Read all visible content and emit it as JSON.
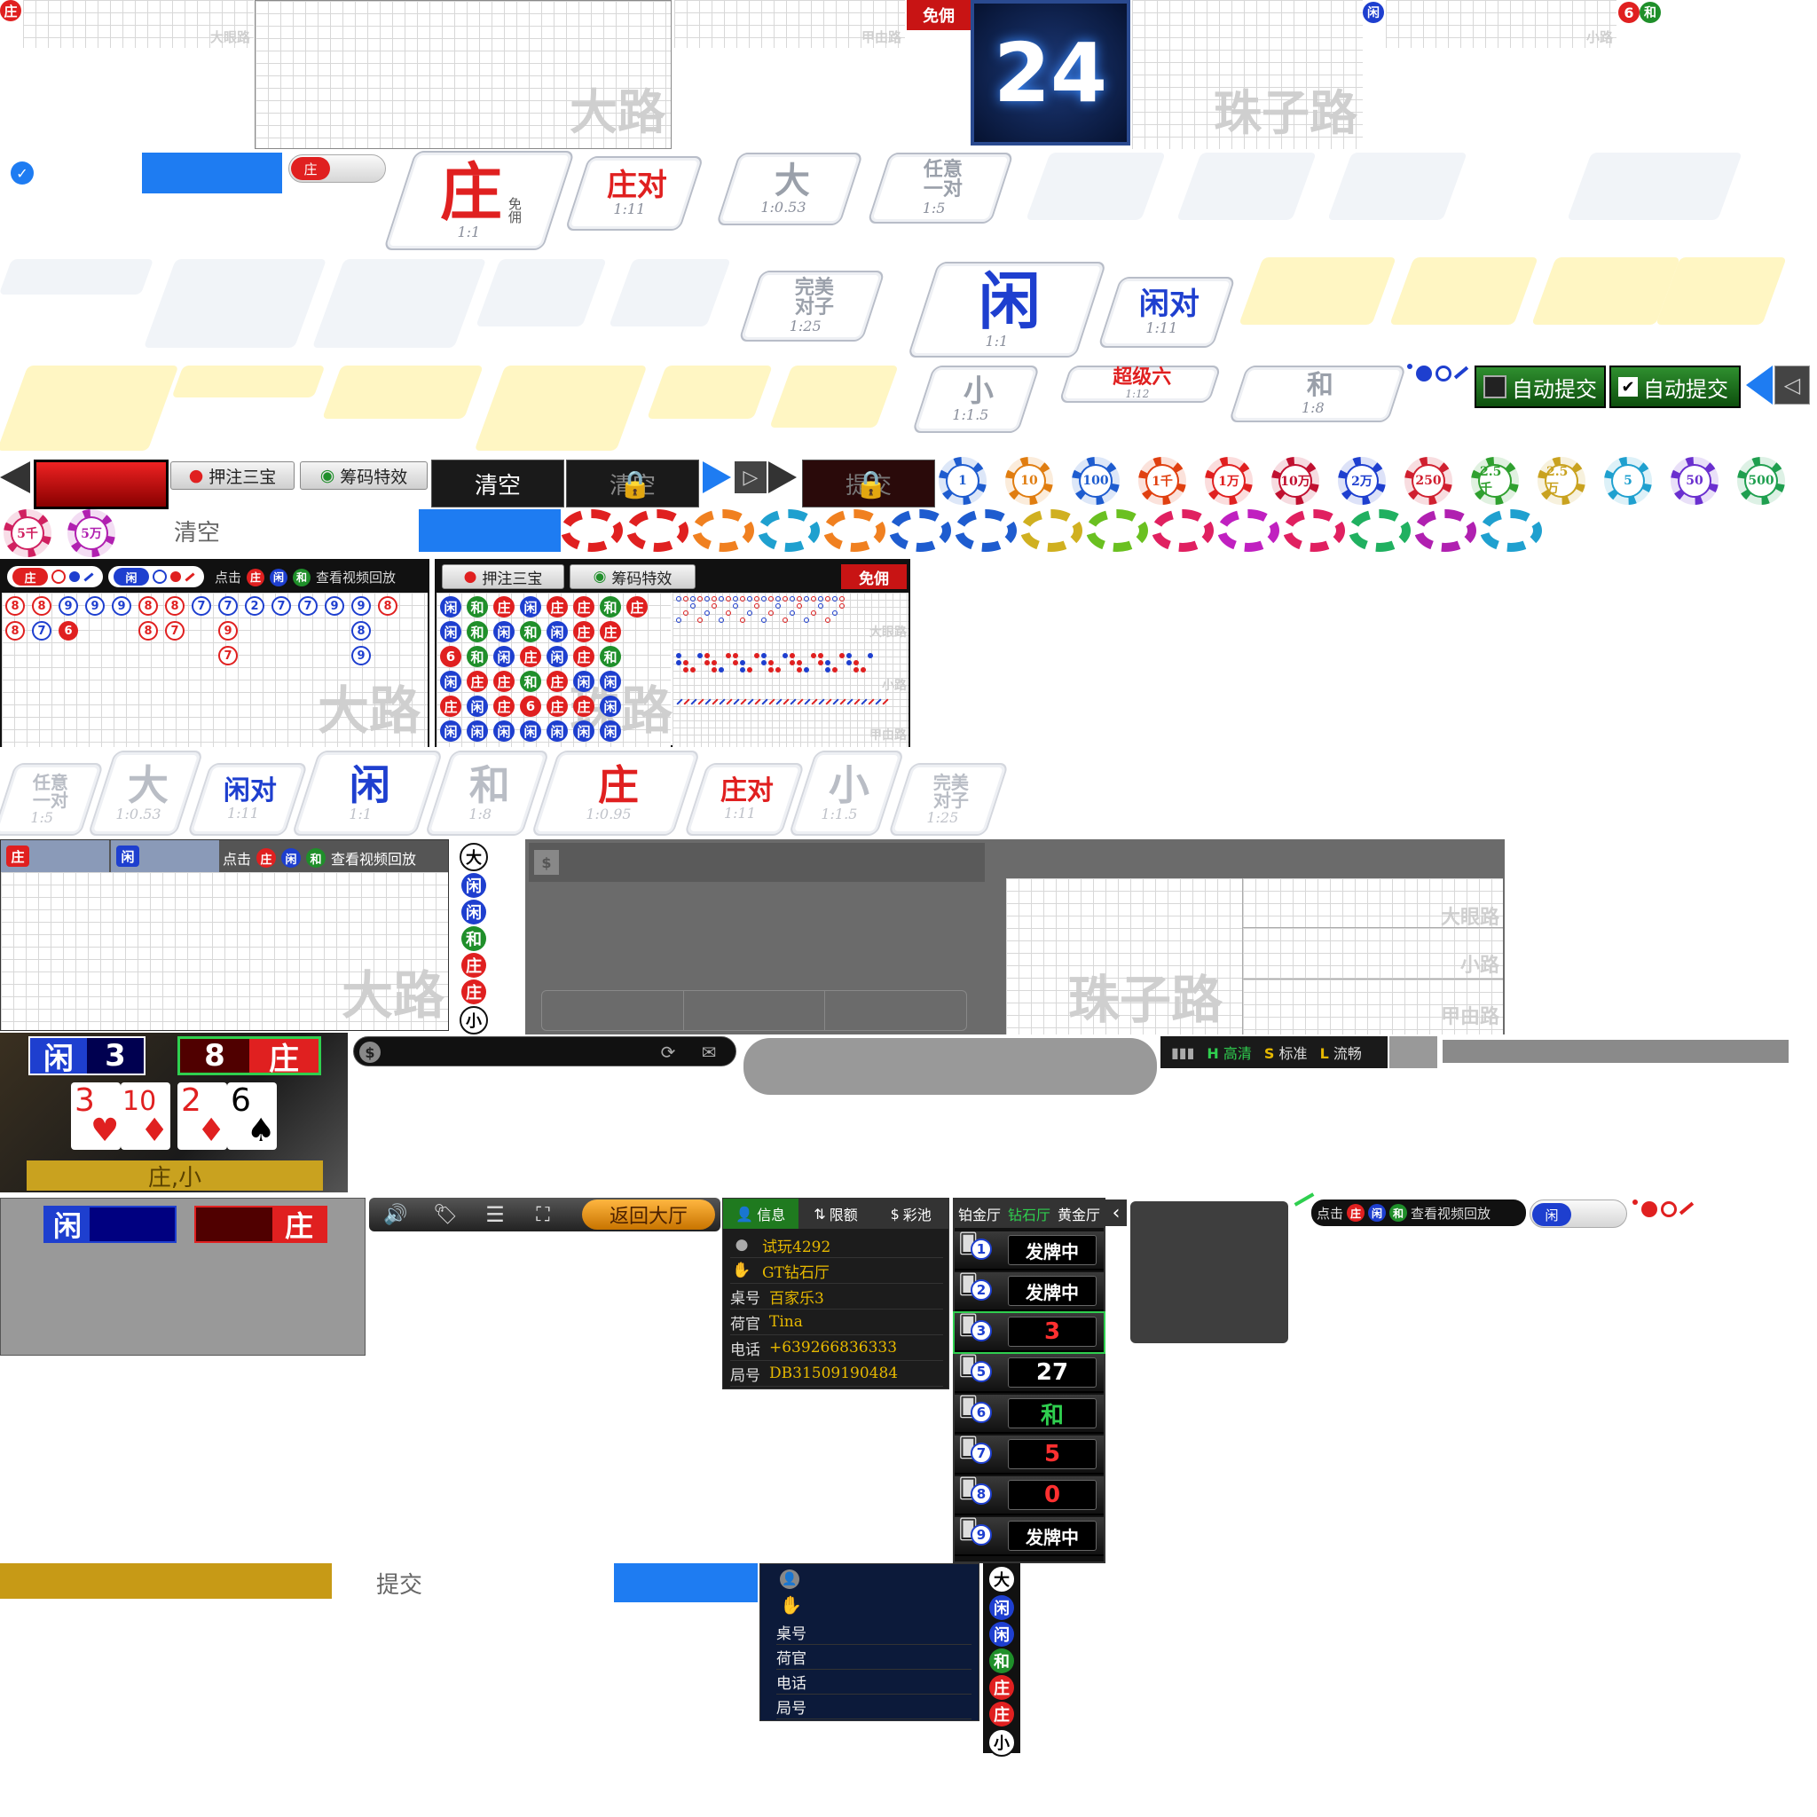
{
  "colors": {
    "banker": "#e02020",
    "player": "#1e3fcf",
    "tie": "#1f8f2a",
    "accent_blue": "#1e7cf2",
    "gold": "#c79a16"
  },
  "top": {
    "banker_badge": "庄",
    "big_eye_road_small": "大眼路",
    "big_road_label": "大路",
    "cockroach_road_small": "甲由路",
    "commission_free": "免佣",
    "countdown": "24",
    "bead_road_label": "珠子路",
    "player_badge": "闲",
    "six_badge": "6",
    "tie_badge": "和",
    "small_road_small": "小路"
  },
  "toggle_banker": "庄",
  "bets_top": [
    {
      "main": "庄",
      "sub": "免佣",
      "odds": "1:1",
      "color": "#e02020"
    },
    {
      "main": "庄对",
      "odds": "1:11",
      "color": "#e02020"
    },
    {
      "main": "大",
      "odds": "1:0.53",
      "color": "#9aa0aa"
    },
    {
      "main": "任意一对",
      "odds": "1:5",
      "color": "#9aa0aa"
    }
  ],
  "bets_mid": [
    {
      "main": "完美对子",
      "odds": "1:25",
      "color": "#9aa0aa"
    },
    {
      "main": "闲",
      "odds": "1:1",
      "color": "#1e3fcf"
    },
    {
      "main": "闲对",
      "odds": "1:11",
      "color": "#1e3fcf"
    }
  ],
  "bets_row3": [
    {
      "main": "小",
      "odds": "1:1.5",
      "color": "#9aa0aa"
    },
    {
      "main": "超级六",
      "odds": "1:12",
      "color": "#e02020"
    },
    {
      "main": "和",
      "odds": "1:8",
      "color": "#9aa0aa"
    }
  ],
  "auto_submit": {
    "off": "自动提交",
    "on": "自动提交"
  },
  "toolbar": {
    "bet_three": "押注三宝",
    "chip_effect": "筹码特效",
    "clear": "清空",
    "clear_locked": "清空",
    "submit_locked": "提交"
  },
  "chips": [
    "1",
    "10",
    "100",
    "1千",
    "1万",
    "10万",
    "2万",
    "250",
    "2.5千",
    "2.5万",
    "5",
    "50",
    "500",
    "5千",
    "5万"
  ],
  "clear_text": "清空",
  "road_panel": {
    "banker_tab": "庄",
    "player_tab": "闲",
    "hint_click": "点击",
    "hint_b": "庄",
    "hint_p": "闲",
    "hint_t": "和",
    "hint_video": "查看视频回放",
    "big_road_wm": "大路",
    "rows": [
      [
        "8",
        "8",
        "9",
        "9",
        "9",
        "8",
        "8",
        "7",
        "7",
        "2",
        "7",
        "7",
        "9",
        "9",
        "8"
      ],
      [
        "8",
        "7",
        "6",
        "",
        "",
        "8",
        "7",
        "",
        "9",
        "",
        "",
        "",
        "",
        "8",
        ""
      ],
      [
        "",
        "",
        "",
        "",
        "",
        "",
        "",
        "",
        "7",
        "",
        "",
        "",
        "",
        "9",
        ""
      ]
    ]
  },
  "bead_panel": {
    "bet_three": "押注三宝",
    "chip_effect": "筹码特效",
    "commission_free": "免佣",
    "bead_rows": [
      [
        "闲",
        "和",
        "庄",
        "闲",
        "庄",
        "庄",
        "和",
        "庄"
      ],
      [
        "闲",
        "和",
        "闲",
        "和",
        "闲",
        "庄",
        "庄",
        ""
      ],
      [
        "6",
        "和",
        "闲",
        "庄",
        "闲",
        "庄",
        "和",
        ""
      ],
      [
        "闲",
        "庄",
        "庄",
        "和",
        "庄",
        "闲",
        "闲",
        ""
      ],
      [
        "庄",
        "闲",
        "庄",
        "6",
        "庄",
        "庄",
        "闲",
        ""
      ],
      [
        "闲",
        "闲",
        "闲",
        "闲",
        "闲",
        "闲",
        "闲",
        ""
      ]
    ],
    "wm": "珠路",
    "big_eye": "大眼路",
    "small": "小路",
    "cockroach": "甲由路"
  },
  "bets_strip": [
    {
      "main": "任意一对",
      "odds": "1:5",
      "color": "#b9bdc5"
    },
    {
      "main": "大",
      "odds": "1:0.53",
      "color": "#b9bdc5"
    },
    {
      "main": "闲对",
      "odds": "1:11",
      "color": "#1e3fcf"
    },
    {
      "main": "闲",
      "odds": "1:1",
      "color": "#1e3fcf"
    },
    {
      "main": "和",
      "odds": "1:8",
      "color": "#b9bdc5"
    },
    {
      "main": "庄",
      "odds": "1:0.95",
      "color": "#e02020"
    },
    {
      "main": "庄对",
      "odds": "1:11",
      "color": "#e02020"
    },
    {
      "main": "小",
      "odds": "1:1.5",
      "color": "#b9bdc5"
    },
    {
      "main": "完美对子",
      "odds": "1:25",
      "color": "#b9bdc5"
    }
  ],
  "road2": {
    "banker": "庄",
    "player": "闲",
    "hint_click": "点击",
    "hint_b": "庄",
    "hint_p": "闲",
    "hint_t": "和",
    "hint_video": "查看视频回放",
    "wm": "大路"
  },
  "side_col": [
    "大",
    "闲",
    "闲",
    "和",
    "庄",
    "庄",
    "小"
  ],
  "bead2": {
    "wm": "珠子路",
    "big_eye": "大眼路",
    "small": "小路",
    "cockroach": "甲由路"
  },
  "cards": {
    "player_label": "闲",
    "player_score": "3",
    "banker_score": "8",
    "banker_label": "庄",
    "p1": "3",
    "p2": "10",
    "b1": "2",
    "b2": "6",
    "result": "庄,小"
  },
  "quality": {
    "h": "H",
    "h_label": "高清",
    "s": "S",
    "s_label": "标准",
    "l": "L",
    "l_label": "流畅"
  },
  "score_bar": {
    "player": "闲",
    "banker": "庄"
  },
  "controls": {
    "back": "返回大厅"
  },
  "info_tabs": {
    "info": "信息",
    "limits": "限额",
    "pool": "彩池"
  },
  "info": [
    {
      "k": "",
      "v": "试玩4292",
      "icon": "user"
    },
    {
      "k": "",
      "v": "GT钻石厅",
      "icon": "hand"
    },
    {
      "k": "桌号",
      "v": "百家乐3"
    },
    {
      "k": "荷官",
      "v": "Tina"
    },
    {
      "k": "电话",
      "v": "+639266836333"
    },
    {
      "k": "局号",
      "v": "DB31509190484"
    }
  ],
  "rooms": {
    "tab1": "铂金厅",
    "tab2": "钻石厅",
    "tab3": "黄金厅",
    "list": [
      {
        "n": "1",
        "s": "发牌中"
      },
      {
        "n": "2",
        "s": "发牌中"
      },
      {
        "n": "3",
        "s": "3"
      },
      {
        "n": "5",
        "s": "27"
      },
      {
        "n": "6",
        "s": "和"
      },
      {
        "n": "7",
        "s": "5"
      },
      {
        "n": "8",
        "s": "0"
      },
      {
        "n": "9",
        "s": "发牌中"
      }
    ]
  },
  "hint3": {
    "click": "点击",
    "b": "庄",
    "p": "闲",
    "t": "和",
    "video": "查看视频回放"
  },
  "toggle_player": "闲",
  "submit_text": "提交",
  "info_blank": [
    "桌号",
    "荷官",
    "电话",
    "局号"
  ],
  "side_col2": [
    "大",
    "闲",
    "闲",
    "和",
    "庄",
    "庄",
    "小"
  ]
}
